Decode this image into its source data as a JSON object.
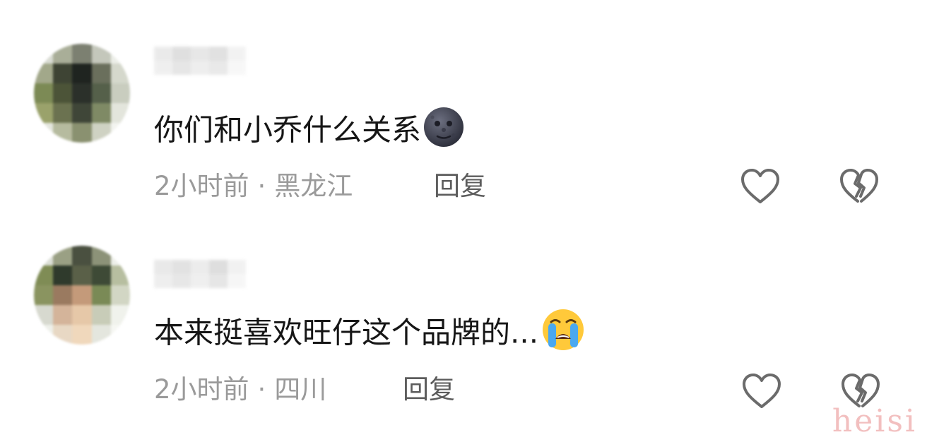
{
  "comments": [
    {
      "text": "你们和小乔什么关系",
      "emoji": "new-moon-face-emoji",
      "time": "2小时前",
      "separator": "·",
      "location": "黑龙江",
      "reply_label": "回复"
    },
    {
      "text": "本来挺喜欢旺仔这个品牌的...",
      "emoji": "loudly-crying-face-emoji",
      "time": "2小时前",
      "separator": "·",
      "location": "四川",
      "reply_label": "回复"
    }
  ],
  "icons": {
    "like": "heart-outline-icon",
    "dislike": "broken-heart-outline-icon"
  },
  "colors": {
    "text": "#161616",
    "meta": "#9a9a9a",
    "reply": "#5c5c5c",
    "icon": "#6b6b6b",
    "watermark": "#f0b4b4"
  },
  "watermark": "heisi"
}
